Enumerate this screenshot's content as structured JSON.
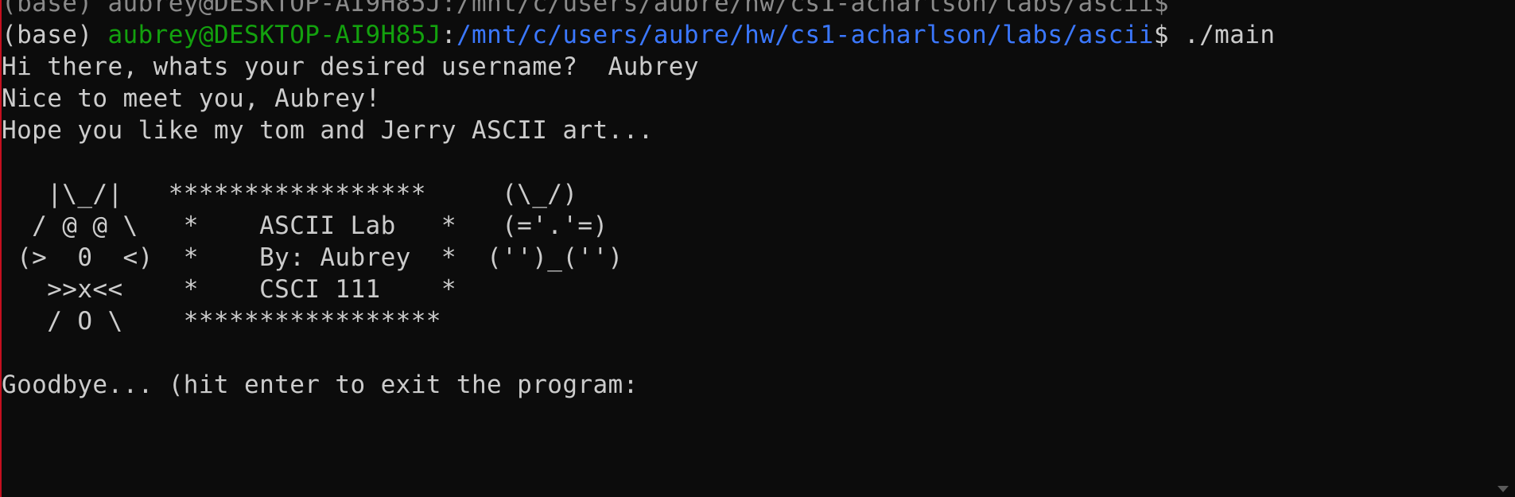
{
  "terminal": {
    "partial_top_line": "(base) aubrey@DESKTOP-AI9H85J:/mnt/c/users/aubre/hw/cs1-acharlson/labs/ascii$",
    "prompt": {
      "env": "(base) ",
      "user_host": "aubrey@DESKTOP-AI9H85J",
      "separator": ":",
      "path": "/mnt/c/users/aubre/hw/cs1-acharlson/labs/ascii",
      "symbol": "$ ",
      "command": "./main"
    },
    "lines": [
      "Hi there, whats your desired username?  Aubrey",
      "Nice to meet you, Aubrey!",
      "Hope you like my tom and Jerry ASCII art...",
      "",
      "   |\\_/|   *****************     (\\_/)",
      "  / @ @ \\   *    ASCII Lab   *   (='.'=)",
      " (>  0  <)  *    By: Aubrey  *  ('')_('')",
      "   >>x<<    *    CSCI 111    *",
      "   / O \\    *****************",
      "",
      "Goodbye... (hit enter to exit the program:"
    ]
  },
  "colors": {
    "background": "#0c0c0c",
    "text": "#cccccc",
    "user_host": "#13a10e",
    "path": "#3b78ff",
    "left_edge": "#c50f1f"
  }
}
